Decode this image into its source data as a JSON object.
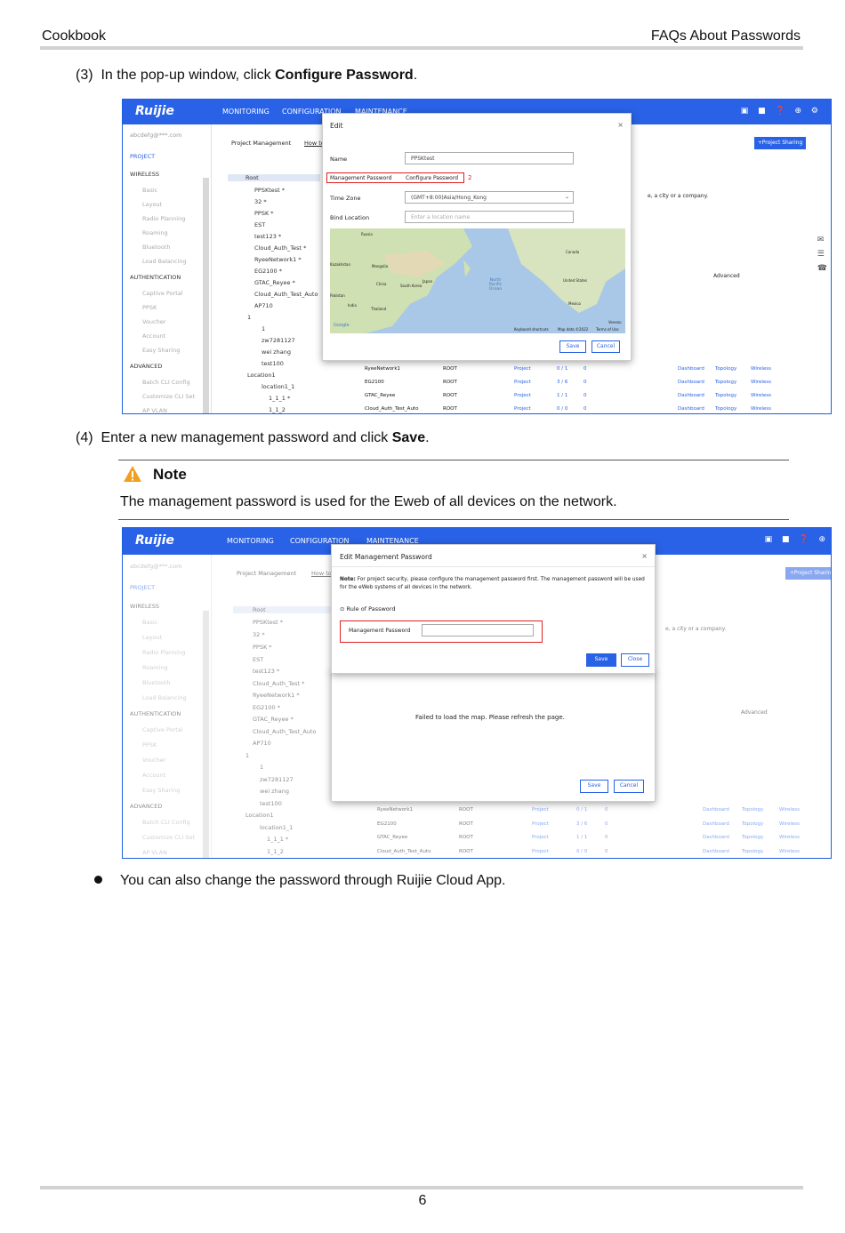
{
  "header": {
    "left": "Cookbook",
    "right": "FAQs About Passwords"
  },
  "step3": {
    "num": "(3)",
    "pre": "In the pop-up window, click ",
    "bold": "Configure Password",
    "post": "."
  },
  "step4": {
    "num": "(4)",
    "pre": "Enter a new management password and click ",
    "bold": "Save",
    "post": "."
  },
  "note": {
    "icon": "warning-icon",
    "title": "Note",
    "text": "The management password is used for the Eweb of all devices on the network."
  },
  "bullet": "You can also change the password through Ruijie Cloud App.",
  "page_number": "6",
  "colors": {
    "accent": "#2962e6",
    "warning": "#f0a020",
    "highlight": "#e02020"
  },
  "app": {
    "logo": "Ruijie",
    "nav": [
      "MONITORING",
      "CONFIGURATION",
      "MAINTENANCE"
    ],
    "account": "abcdefg@***.com",
    "sidebar": {
      "project": "PROJECT",
      "wireless": "WIRELESS",
      "wireless_items": [
        "Basic",
        "Layout",
        "Radio Planning",
        "Roaming",
        "Bluetooth",
        "Load Balancing"
      ],
      "authentication": "AUTHENTICATION",
      "auth_items": [
        "Captive Portal",
        "PPSK",
        "Voucher",
        "Account",
        "Easy Sharing"
      ],
      "advanced": "ADVANCED",
      "adv_items": [
        "Batch CLI Config",
        "Customize CLI Set",
        "AP VLAN"
      ]
    },
    "project_management": "Project Management",
    "how_to": "How to",
    "project_sharing": "+Project Sharing",
    "tree": [
      "Root",
      "PPSKtest *",
      "32 *",
      "PPSK *",
      "EST",
      "test123 *",
      "Cloud_Auth_Test *",
      "RyeeNetwork1 *",
      "EG2100 *",
      "GTAC_Reyee *",
      "Cloud_Auth_Test_Auto",
      "AP710",
      "1",
      "1",
      "zw7281127",
      "wei zhang",
      "test100",
      "Location1",
      "location1_1",
      "1_1_1 *",
      "1_1_2"
    ],
    "search_hint": "e, a city or a company.",
    "advanced_col": "Advanced",
    "table_rows": [
      {
        "name": "RyeeNetwork1",
        "parent": "ROOT",
        "type": "Project",
        "count": "0 / 1",
        "n": "0"
      },
      {
        "name": "EG2100",
        "parent": "ROOT",
        "type": "Project",
        "count": "3 / 6",
        "n": "0"
      },
      {
        "name": "GTAC_Reyee",
        "parent": "ROOT",
        "type": "Project",
        "count": "1 / 1",
        "n": "0"
      },
      {
        "name": "Cloud_Auth_Test_Auto",
        "parent": "ROOT",
        "type": "Project",
        "count": "0 / 0",
        "n": "0"
      }
    ],
    "links": [
      "Dashboard",
      "Topology",
      "Wireless"
    ]
  },
  "edit_modal": {
    "title": "Edit",
    "name_label": "Name",
    "name_value": "PPSKtest",
    "mgmt_label": "Management Password",
    "mgmt_link": "Configure Password",
    "marker": "2",
    "tz_label": "Time Zone",
    "tz_value": "(GMT+8:00)Asia/Hong_Kong",
    "loc_label": "Bind Location",
    "loc_placeholder": "Enter a location name",
    "map_labels": [
      "Russia",
      "Mongolia",
      "China",
      "South Korea",
      "Japan",
      "Kazakhstan",
      "Pakistan",
      "India",
      "Thailand",
      "North Pacific Ocean",
      "Canada",
      "United States",
      "Mexico",
      "Venezu"
    ],
    "map_footer": [
      "Google",
      "Keyboard shortcuts",
      "Map data ©2022",
      "Terms of Use"
    ],
    "save": "Save",
    "cancel": "Cancel"
  },
  "pwd_modal": {
    "title": "Edit Management Password",
    "note_bold": "Note:",
    "note_text": "For project security, please configure the management password first. The management password will be used for the eWeb systems of all devices in the network.",
    "rule_link": "Rule of Password",
    "field_label": "Management Password",
    "save": "Save",
    "close": "Close",
    "map_error": "Failed to load the map. Please refresh the page.",
    "save2": "Save",
    "cancel2": "Cancel"
  }
}
